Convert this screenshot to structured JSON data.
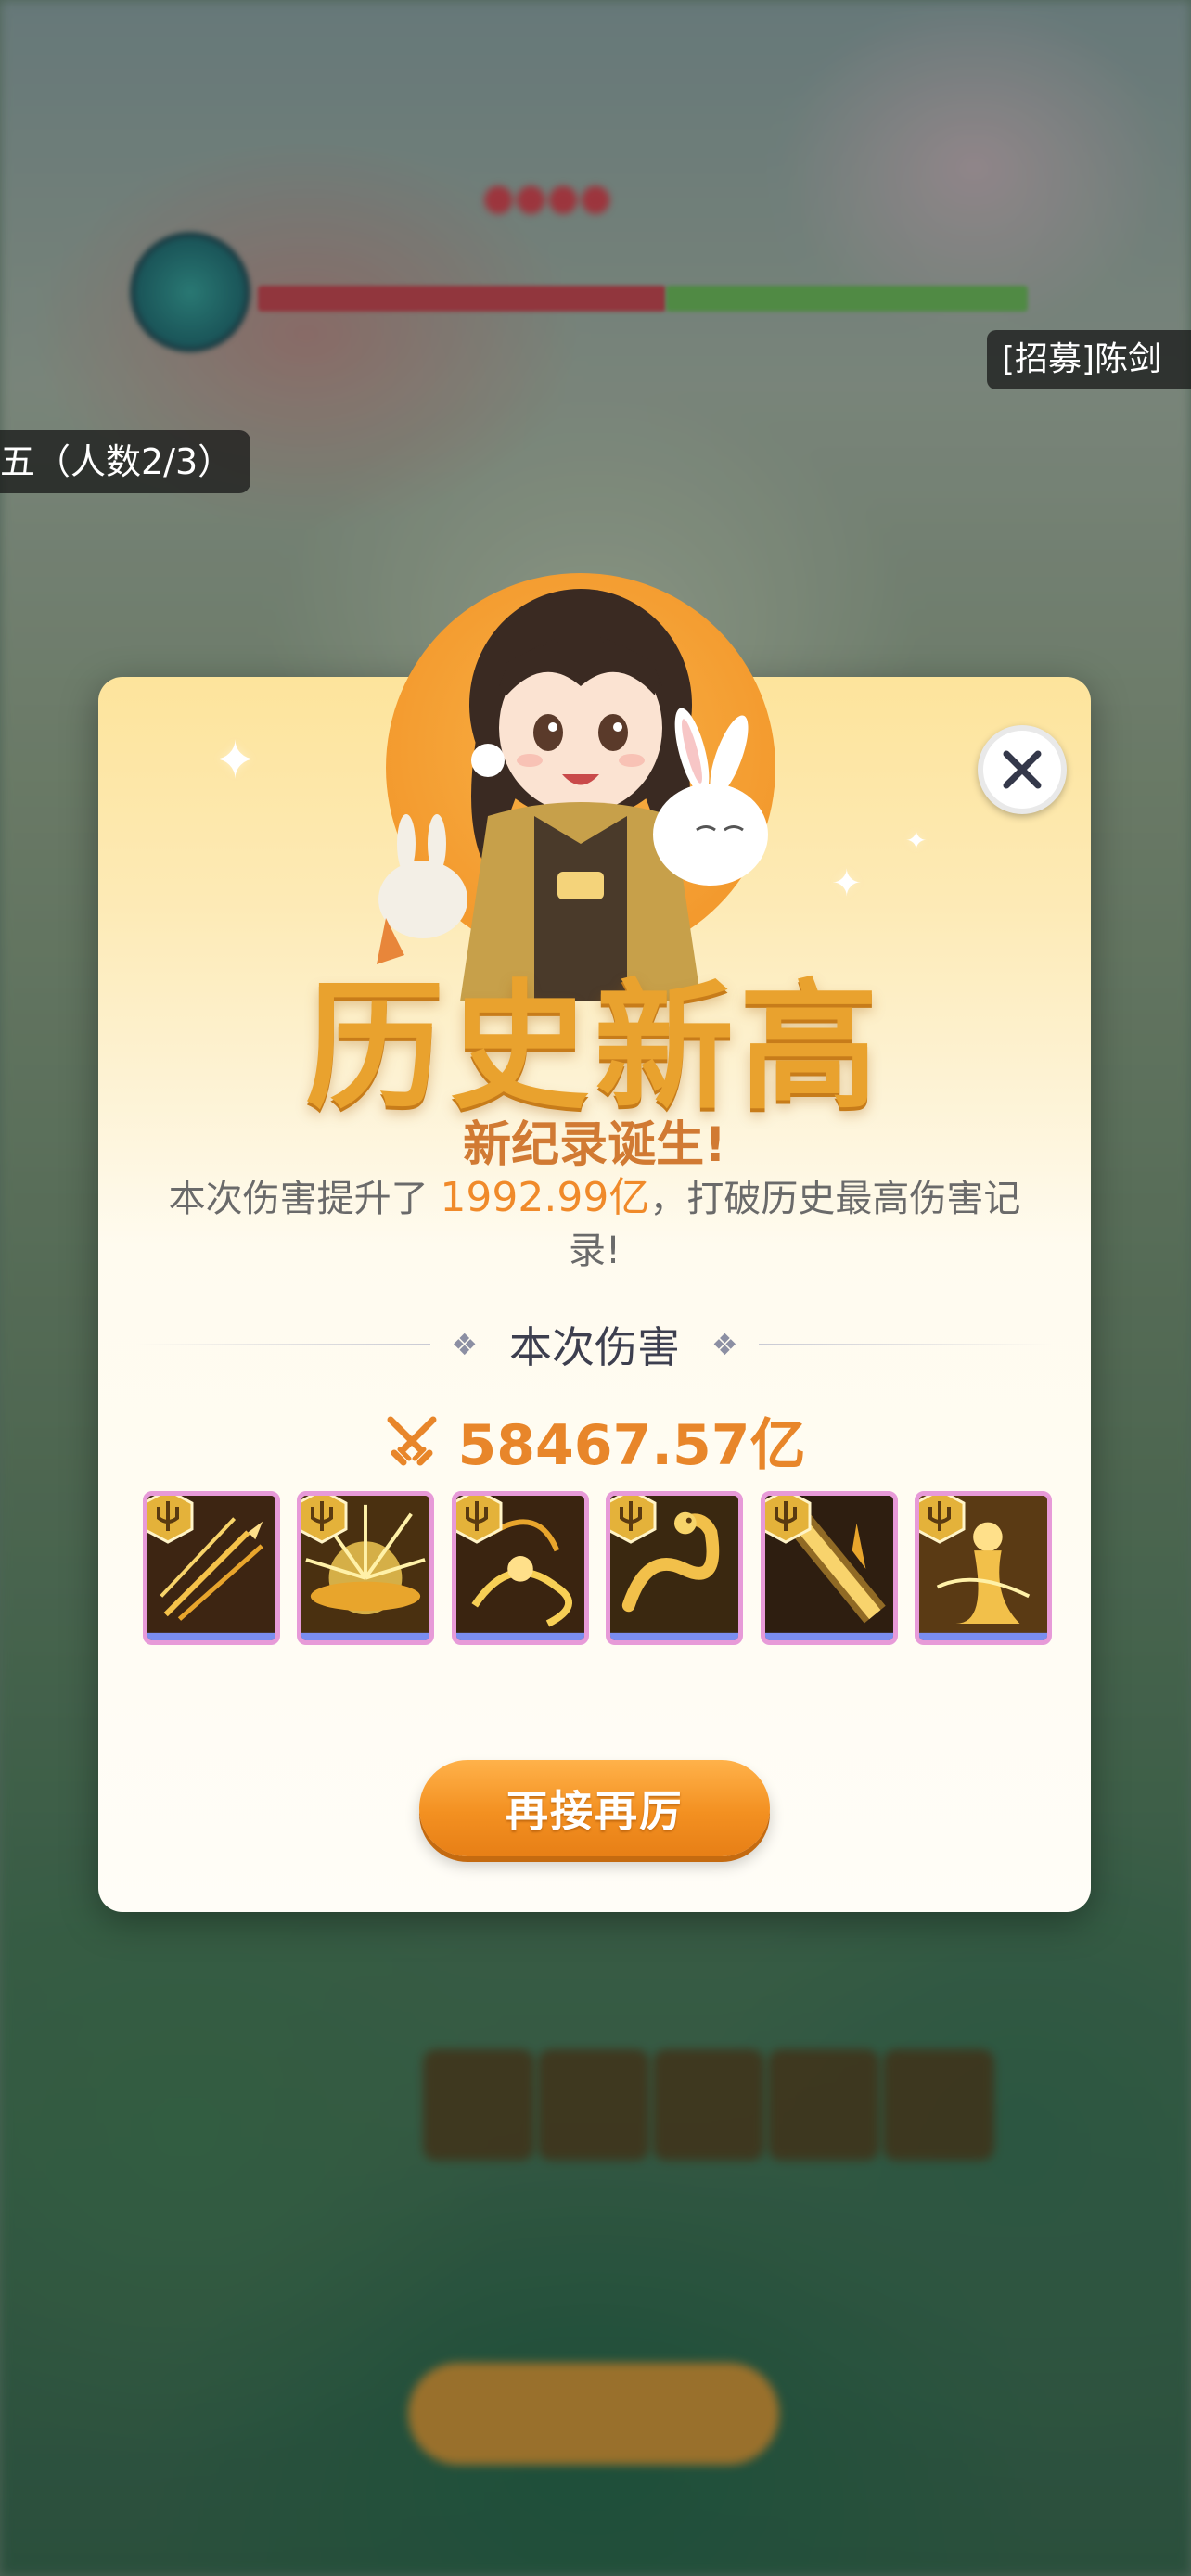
{
  "background": {
    "recruit_tag": "[招募]陈剑",
    "team_tag": "五（人数2/3）"
  },
  "modal": {
    "title": "历史新高",
    "subtitle": "新纪录诞生!",
    "desc_prefix": "本次伤害提升了",
    "desc_highlight": "1992.99亿",
    "desc_suffix": "，打破历史最高伤害记录!",
    "section_label": "本次伤害",
    "damage_value": "58467.57亿",
    "skills": [
      {
        "name": "golden-swords-skill"
      },
      {
        "name": "golden-burst-skill"
      },
      {
        "name": "golden-swirl-skill"
      },
      {
        "name": "golden-dragon-skill"
      },
      {
        "name": "golden-beam-skill"
      },
      {
        "name": "golden-maiden-skill"
      }
    ],
    "primary_button": "再接再厉",
    "close_icon": "close-icon"
  },
  "colors": {
    "accent_orange": "#f08a2a",
    "title_gold": "#e9a22e",
    "button_orange": "#f39021"
  }
}
